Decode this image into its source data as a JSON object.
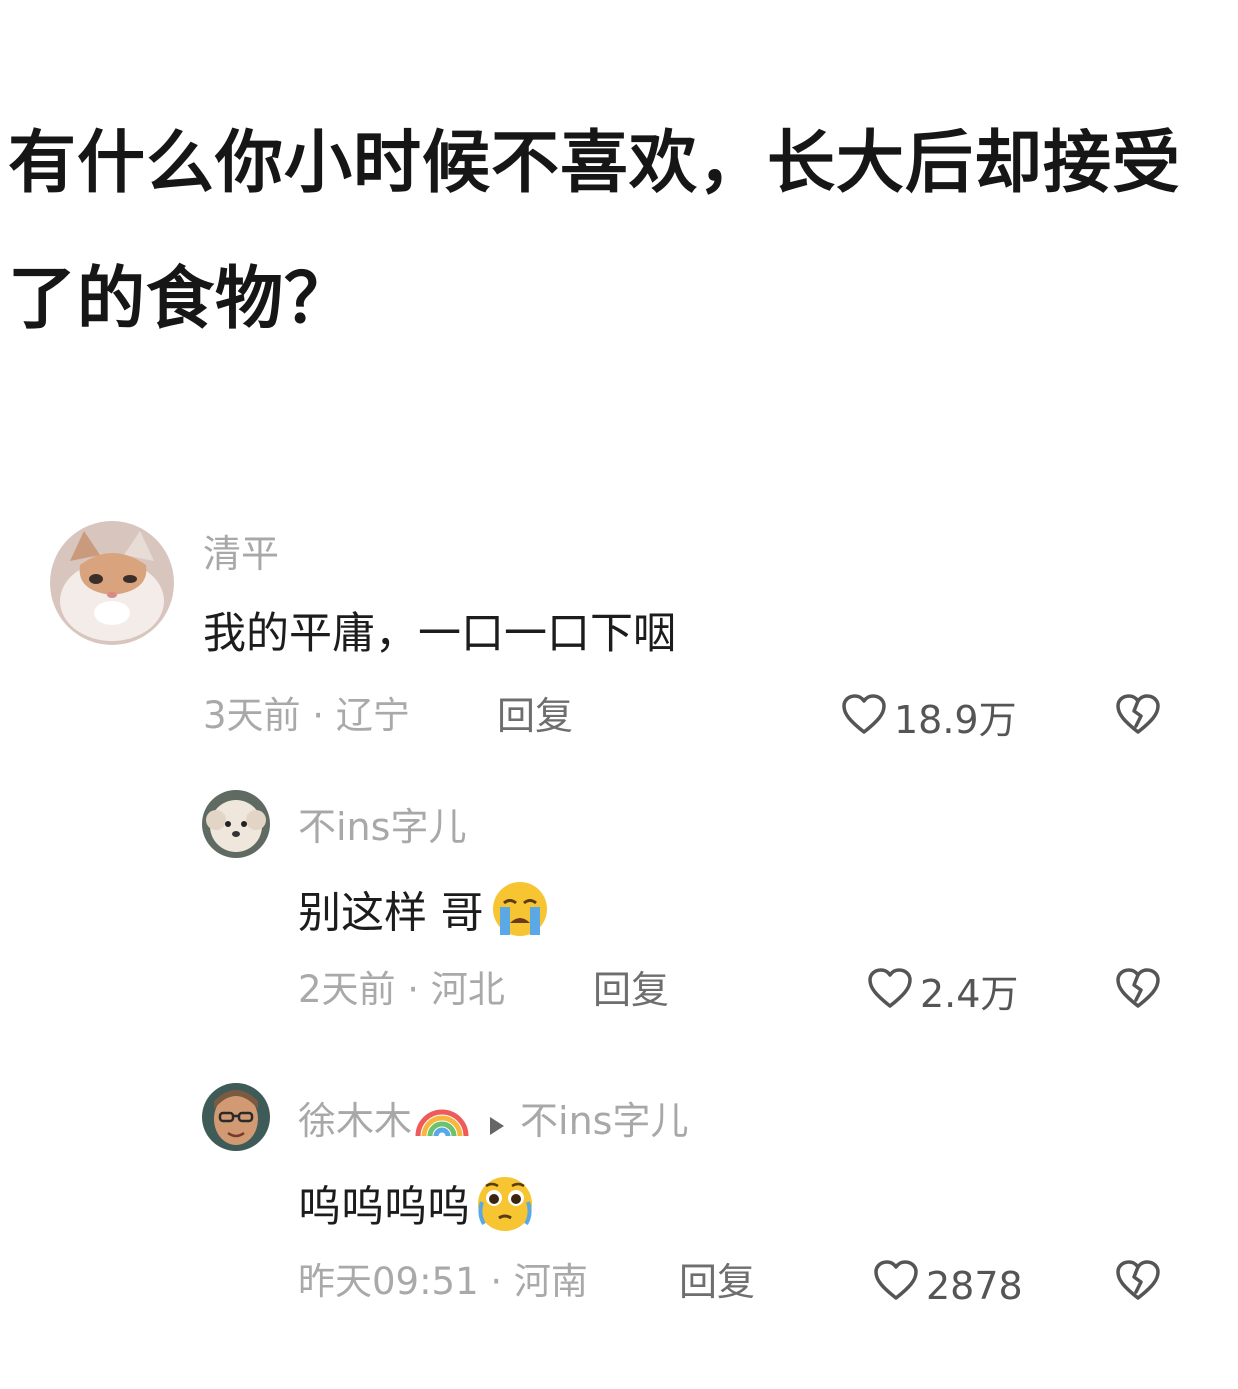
{
  "question": "有什么你小时候不喜欢，长大后却接受了的食物？",
  "comments": [
    {
      "author": "清平",
      "text": "我的平庸，一口一口下咽",
      "time_location": "3天前 · 辽宁",
      "reply_label": "回复",
      "likes": "18.9万"
    },
    {
      "author": "不ins字儿",
      "text": "别这样 哥",
      "time_location": "2天前 · 河北",
      "reply_label": "回复",
      "likes": "2.4万"
    },
    {
      "author": "徐木木",
      "reply_to": "不ins字儿",
      "text": "呜呜呜呜",
      "time_location": "昨天09:51 · 河南",
      "reply_label": "回复",
      "likes": "2878"
    }
  ],
  "icons": {
    "like": "heart-outline-icon",
    "dislike": "broken-heart-icon",
    "emoji_1": "loudly-crying-face-emoji",
    "emoji_2": "pleading-face-emoji",
    "author_badge": "rainbow-emoji",
    "reply_arrow": "triangle-right-icon"
  }
}
